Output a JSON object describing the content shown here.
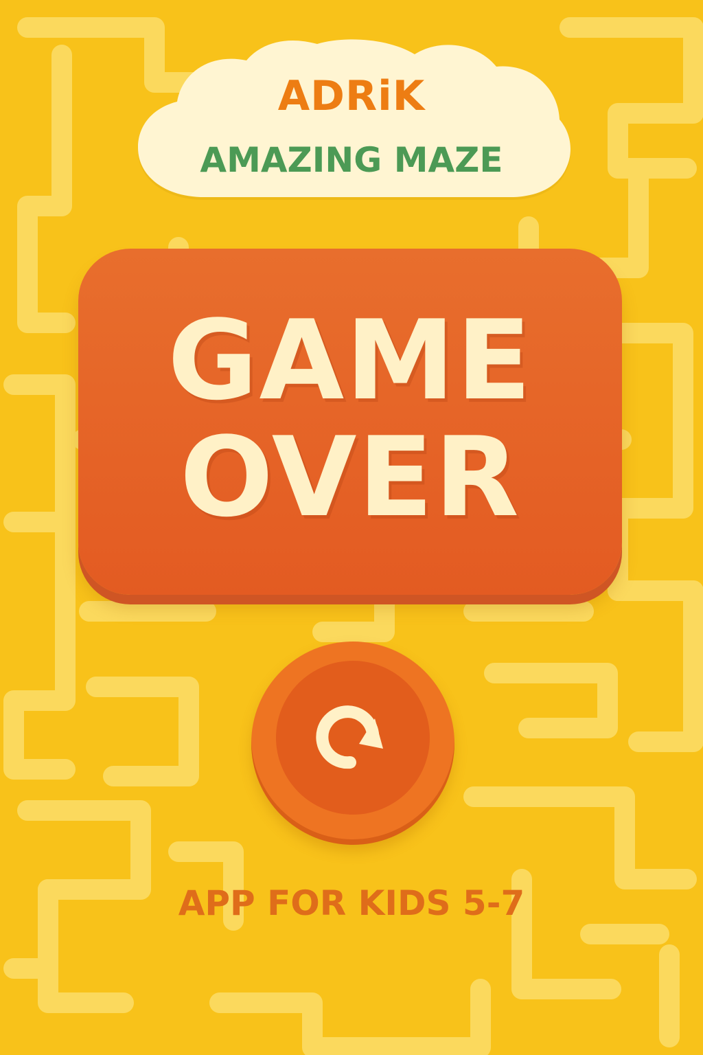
{
  "app": {
    "title_line_1": "ADRiK",
    "title_line_2": "AMAZING MAZE"
  },
  "status": {
    "game_over_text": "GAME\nOVER"
  },
  "controls": {
    "replay_icon": "replay-icon"
  },
  "footer": {
    "audience_text": "APP FOR KIDS 5-7"
  },
  "colors": {
    "background": "#f8c21a",
    "maze_path": "#fbd95d",
    "title_cloud": "#fff5d2",
    "title_primary": "#ed7d13",
    "title_secondary": "#4c9a55",
    "panel": "#e86e2d",
    "panel_text": "#fff1c7",
    "button_outer": "#ee7422",
    "button_inner": "#e25d1c"
  }
}
